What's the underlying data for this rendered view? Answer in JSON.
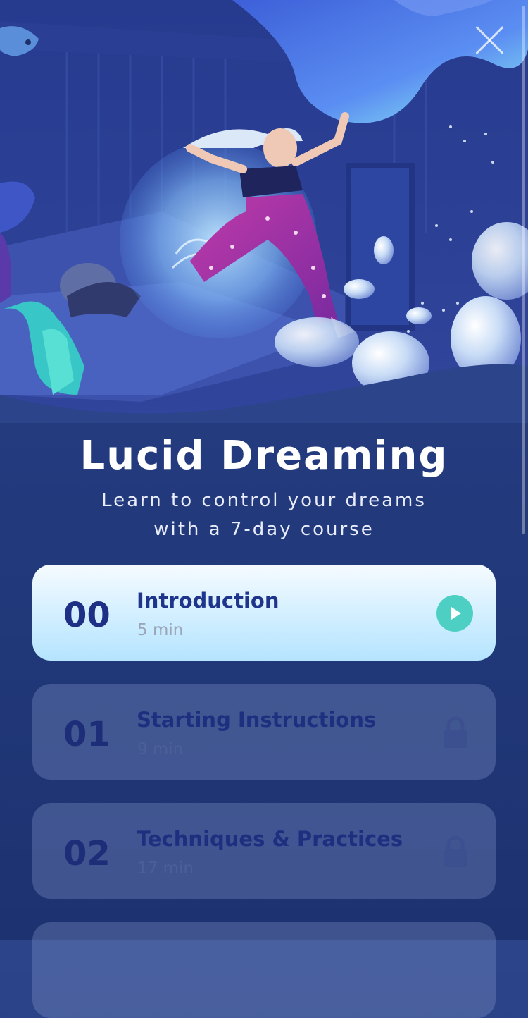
{
  "course": {
    "title": "Lucid Dreaming",
    "subtitle_line1": "Learn to control your dreams",
    "subtitle_line2": "with a 7-day course"
  },
  "lessons": [
    {
      "number": "00",
      "title": "Introduction",
      "duration": "5 min",
      "state": "playable"
    },
    {
      "number": "01",
      "title": "Starting Instructions",
      "duration": "9 min",
      "state": "locked"
    },
    {
      "number": "02",
      "title": "Techniques & Practices",
      "duration": "17 min",
      "state": "locked"
    }
  ],
  "icons": {
    "close": "close-icon",
    "play": "play-icon",
    "lock": "lock-icon"
  },
  "colors": {
    "background": "#223a7c",
    "accent_play": "#4ecfc4",
    "active_card": "#c7ebff",
    "heading_text": "#1f348b"
  }
}
